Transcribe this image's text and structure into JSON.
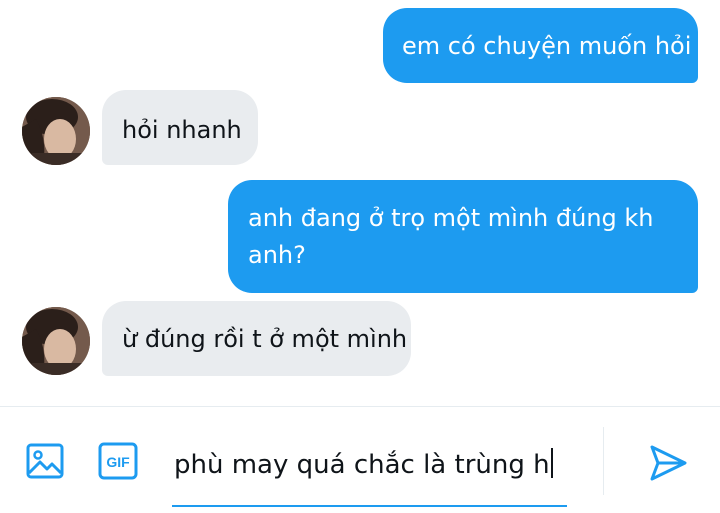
{
  "messages": [
    {
      "direction": "outgoing",
      "text": "em có chuyện muốn hỏi"
    },
    {
      "direction": "incoming",
      "text": "hỏi nhanh"
    },
    {
      "direction": "outgoing",
      "text": "anh đang ở trọ một mình đúng kh anh?"
    },
    {
      "direction": "incoming",
      "text": "ừ đúng rồi t ở một mình"
    }
  ],
  "composer": {
    "draft_text": "phù may quá chắc là trùng h",
    "gif_label": "GIF",
    "icons": {
      "image": "image-icon",
      "gif": "gif-icon",
      "send": "send-icon"
    }
  },
  "colors": {
    "accent": "#1d9bf0",
    "incoming_bubble": "#e9ecef",
    "text": "#0f1419"
  }
}
